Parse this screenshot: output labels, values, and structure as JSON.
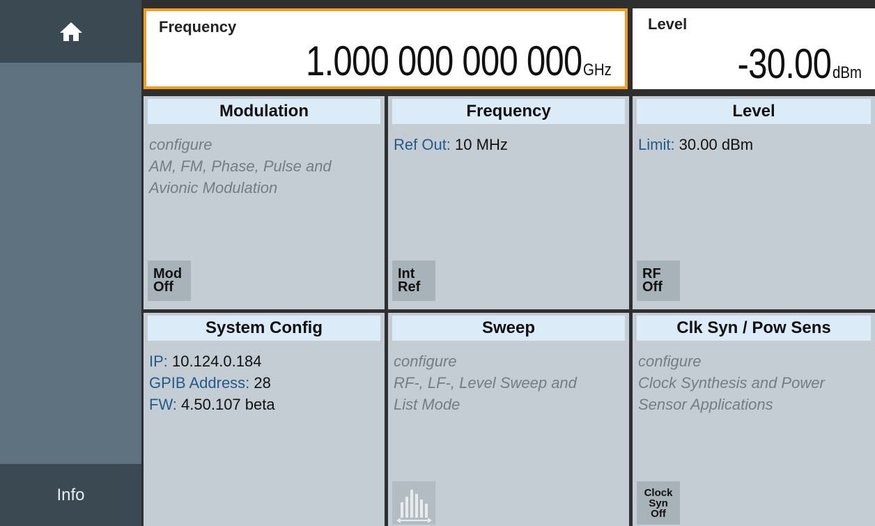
{
  "sidebar": {
    "home_icon": "home-icon",
    "info_label": "Info"
  },
  "header": {
    "frequency": {
      "label": "Frequency",
      "value": "1.000 000 000 000",
      "unit": "GHz"
    },
    "level": {
      "label": "Level",
      "value": "-30.00",
      "unit": "dBm"
    }
  },
  "tiles": [
    {
      "title": "Modulation",
      "desc_lines": [
        "configure",
        "AM, FM, Phase, Pulse and",
        "Avionic Modulation"
      ],
      "button": [
        "Mod",
        "Off"
      ]
    },
    {
      "title": "Frequency",
      "key": "Ref Out:",
      "value": " 10 MHz",
      "button": [
        "Int",
        "Ref"
      ]
    },
    {
      "title": "Level",
      "key": "Limit:",
      "value": " 30.00 dBm",
      "button": [
        "RF",
        "Off"
      ]
    },
    {
      "title": "System Config",
      "rows": [
        {
          "key": "IP:",
          "value": " 10.124.0.184"
        },
        {
          "key": "GPIB Address:",
          "value": " 28"
        },
        {
          "key": "FW:",
          "value": " 4.50.107 beta"
        }
      ]
    },
    {
      "title": "Sweep",
      "desc_lines": [
        "configure",
        "RF-, LF-, Level Sweep and",
        "List Mode"
      ],
      "icon": "sweep-icon"
    },
    {
      "title": "Clk Syn / Pow Sens",
      "desc_lines": [
        "configure",
        "Clock Synthesis and Power",
        "Sensor Applications"
      ],
      "button": [
        "Clock",
        "Syn",
        "Off"
      ]
    }
  ],
  "colors": {
    "accent": "#f39c1f",
    "key_text": "#1f5c8a",
    "tile_bg": "#c4cdd3",
    "title_bg": "#dcebf8",
    "sidebar": "#5e7280"
  }
}
